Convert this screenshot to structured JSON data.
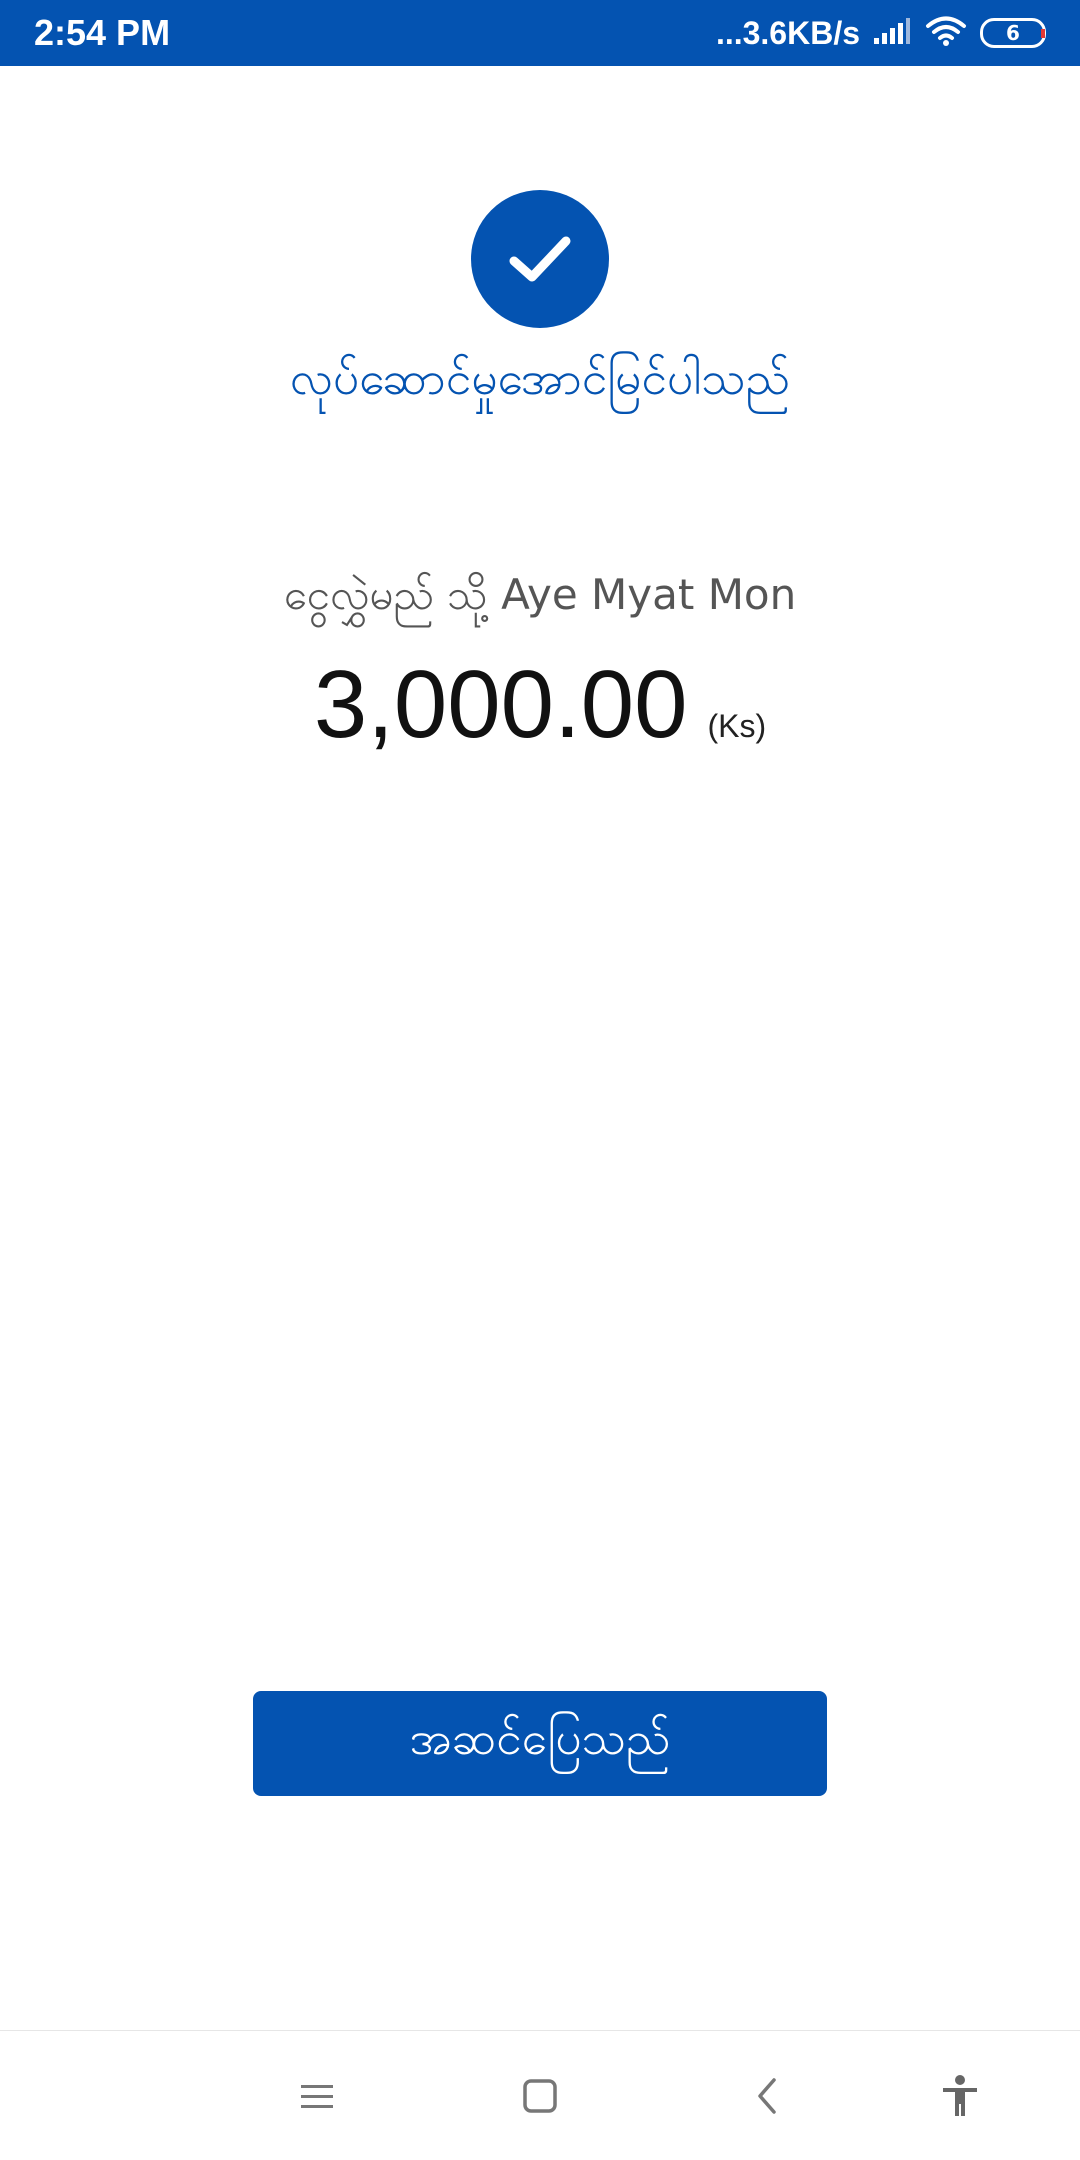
{
  "status_bar": {
    "time": "2:54 PM",
    "network_speed": "...3.6KB/s",
    "battery_level": "6",
    "icons": [
      "signal-icon",
      "wifi-icon",
      "battery-icon"
    ]
  },
  "result": {
    "icon": "check-icon",
    "message": "လုပ်ဆောင်မှုအောင်မြင်ပါသည်"
  },
  "transfer": {
    "recipient_line": "ငွေလွှဲမည် သို့ Aye Myat Mon",
    "amount": "3,000.00",
    "currency": "(Ks)"
  },
  "actions": {
    "done_label": "အဆင်ပြေသည်"
  },
  "nav": {
    "icons": [
      "menu-icon",
      "home-icon",
      "back-icon",
      "accessibility-icon"
    ]
  },
  "colors": {
    "primary": "#0453b1",
    "text_dark": "#111111",
    "text_muted": "#555555"
  }
}
